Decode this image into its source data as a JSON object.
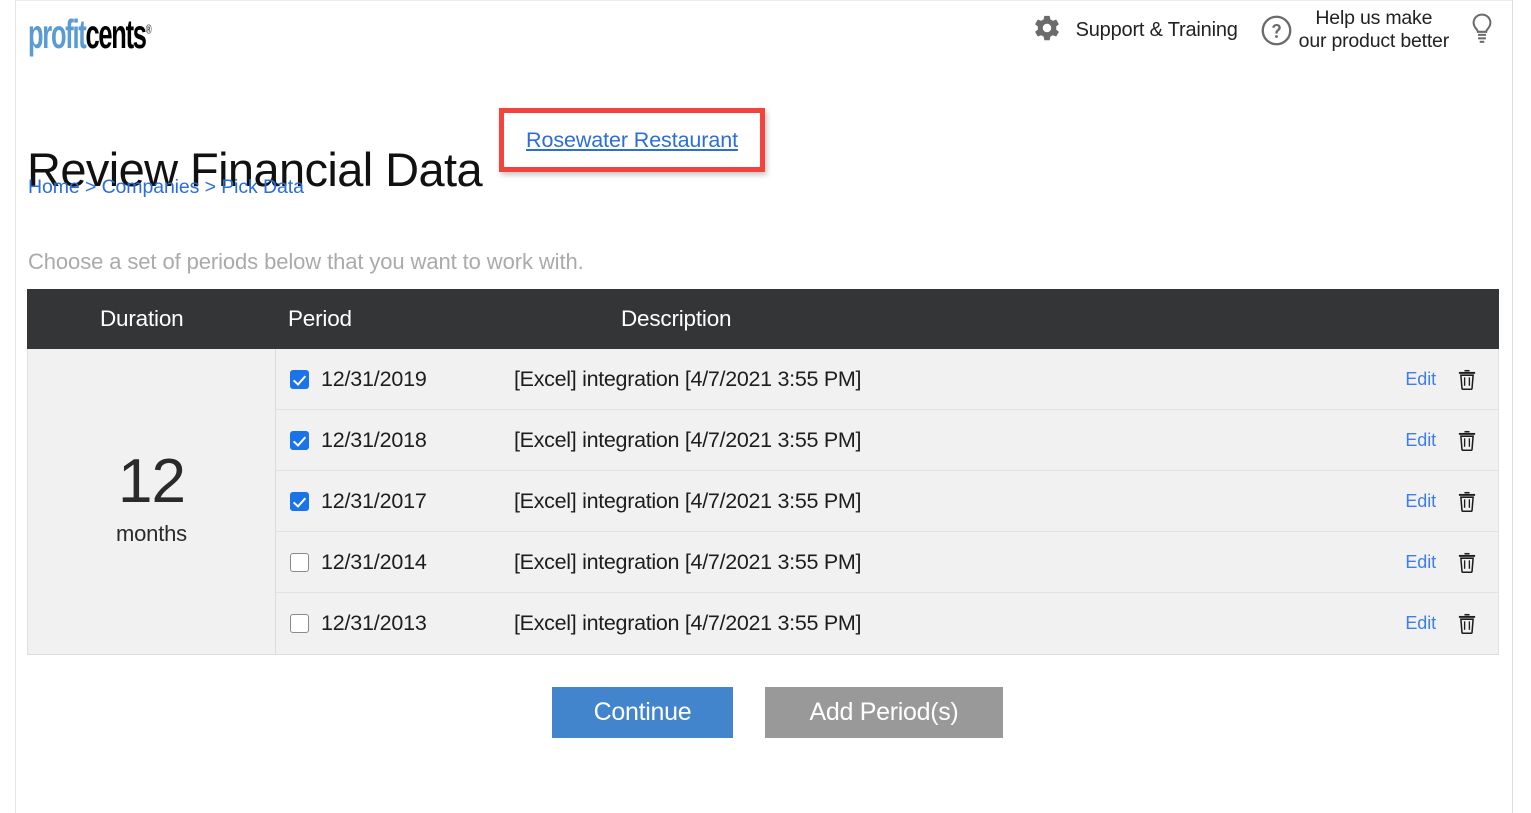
{
  "brand": {
    "logo_part1": "profit",
    "logo_part2": "cents",
    "registered_mark": "®",
    "color_blue": "#5b9bd5",
    "color_black": "#000000"
  },
  "header": {
    "gear_icon": "gear-icon",
    "support_label": "Support & Training",
    "question_icon": "question-circle-icon",
    "help_line1": "Help us make",
    "help_line2": "our product better",
    "bulb_icon": "lightbulb-icon"
  },
  "title": {
    "page_title": "Review Financial Data",
    "company_name": "Rosewater Restaurant",
    "highlight_color": "#f4433c"
  },
  "breadcrumb": {
    "items": [
      "Home",
      "Companies",
      "Pick Data"
    ],
    "separator": ">"
  },
  "subtitle": "Choose a set of periods below that you want to work with.",
  "table": {
    "headers": {
      "duration": "Duration",
      "period": "Period",
      "description": "Description"
    },
    "duration": {
      "value": "12",
      "unit": "months"
    },
    "header_bg": "#333537",
    "row_bg": "#f1f1f1",
    "rows": [
      {
        "checked": true,
        "period": "12/31/2019",
        "description": "[Excel] integration [4/7/2021 3:55 PM]",
        "edit_label": "Edit",
        "delete_icon": "trash-icon"
      },
      {
        "checked": true,
        "period": "12/31/2018",
        "description": "[Excel] integration [4/7/2021 3:55 PM]",
        "edit_label": "Edit",
        "delete_icon": "trash-icon"
      },
      {
        "checked": true,
        "period": "12/31/2017",
        "description": "[Excel] integration [4/7/2021 3:55 PM]",
        "edit_label": "Edit",
        "delete_icon": "trash-icon"
      },
      {
        "checked": false,
        "period": "12/31/2014",
        "description": "[Excel] integration [4/7/2021 3:55 PM]",
        "edit_label": "Edit",
        "delete_icon": "trash-icon"
      },
      {
        "checked": false,
        "period": "12/31/2013",
        "description": "[Excel] integration [4/7/2021 3:55 PM]",
        "edit_label": "Edit",
        "delete_icon": "trash-icon"
      }
    ]
  },
  "actions": {
    "continue_label": "Continue",
    "continue_color": "#4285cc",
    "add_periods_label": "Add Period(s)",
    "add_periods_color": "#999999"
  }
}
